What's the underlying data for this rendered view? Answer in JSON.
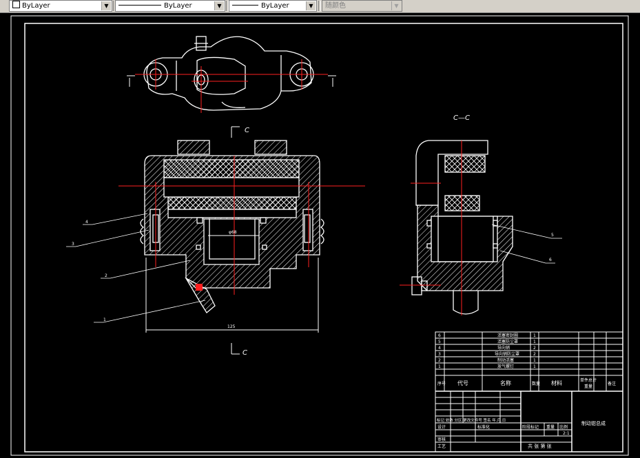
{
  "toolbar": {
    "color_combo": {
      "value": "ByLayer"
    },
    "linetype_combo": {
      "value": "ByLayer"
    },
    "lineweight_combo": {
      "value": "ByLayer"
    },
    "plotstyle_combo": {
      "value": "随颜色",
      "enabled": false
    }
  },
  "drawing": {
    "section_label_top": "C",
    "section_label_bottom": "C",
    "section_view_title": "C—C",
    "dimension": "125",
    "bore_label": "φ68",
    "leader_numbers_left": [
      "4",
      "3",
      "2",
      "1"
    ],
    "leader_numbers_right": [
      "5",
      "6"
    ]
  },
  "title_block": {
    "parts": [
      {
        "no": "6",
        "name": "活塞密封圈",
        "qty": "1"
      },
      {
        "no": "5",
        "name": "活塞防尘罩",
        "qty": "1"
      },
      {
        "no": "4",
        "name": "导向销",
        "qty": "2"
      },
      {
        "no": "3",
        "name": "导向销防尘罩",
        "qty": "2"
      },
      {
        "no": "2",
        "name": "制动活塞",
        "qty": "1"
      },
      {
        "no": "1",
        "name": "放气螺钉",
        "qty": "1"
      }
    ],
    "header": {
      "seq": "序号",
      "code": "代号",
      "name": "名称",
      "qty": "数量",
      "material": "材料",
      "unit_weight": "单件总计",
      "weight": "重量",
      "remark": "备注"
    },
    "revision_row": "标记 处数 分区 更改文件号 签名 年.月.日",
    "design": "设计",
    "standardization": "标准化",
    "stage_mark": "阶段标记",
    "weight_label": "重量",
    "scale_label": "比例",
    "scale_value": "2:1",
    "review": "审核",
    "process": "工艺",
    "sheet_info": "共 张 第 张",
    "drawing_title": "制动钳总成"
  }
}
